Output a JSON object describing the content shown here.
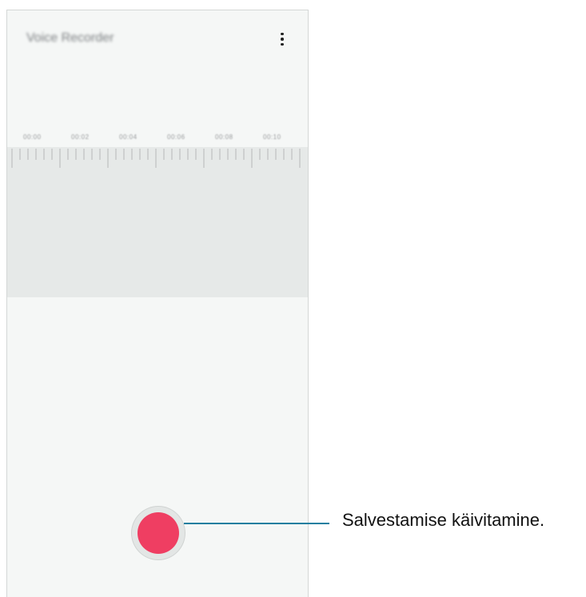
{
  "app": {
    "title": "Voice Recorder"
  },
  "header": {
    "menu_icon": "more-vertical-icon"
  },
  "timeline": {
    "labels": [
      "00:00",
      "00:02",
      "00:04",
      "00:06",
      "00:08",
      "00:10"
    ]
  },
  "controls": {
    "record_icon": "record-circle-icon",
    "record_color": "#ef3e62"
  },
  "annotation": {
    "text": "Salvestamise käivitamine.",
    "line_color": "#1f7fa0"
  }
}
